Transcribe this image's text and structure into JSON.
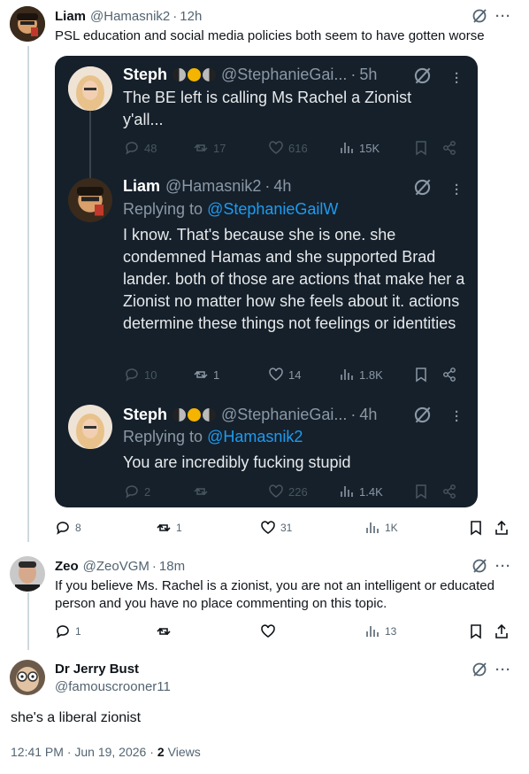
{
  "main_post": {
    "author_name": "Liam",
    "handle": "@Hamasnik2",
    "time": "12h",
    "text": "PSL education and social media policies both seem to have gotten worse",
    "stats": {
      "replies": "8",
      "reposts": "1",
      "likes": "31",
      "views": "1K"
    }
  },
  "card": {
    "posts": [
      {
        "author_name": "Steph",
        "handle": "@StephanieGai...",
        "time": "5h",
        "text": "The BE left is calling Ms Rachel a Zionist y'all...",
        "stats": {
          "replies": "48",
          "reposts": "17",
          "likes": "616",
          "views": "15K"
        }
      },
      {
        "author_name": "Liam",
        "handle": "@Hamasnik2",
        "time": "4h",
        "replying_label": "Replying to",
        "replying_to": "@StephanieGailW",
        "text": "I know. That's because she is one. she condemned Hamas and she supported Brad lander. both of those are actions that make her a Zionist no matter how she feels about it. actions determine these things not feelings or identities",
        "stats": {
          "replies": "10",
          "reposts": "1",
          "likes": "14",
          "views": "1.8K"
        }
      },
      {
        "author_name": "Steph",
        "handle": "@StephanieGai...",
        "time": "4h",
        "replying_label": "Replying to",
        "replying_to": "@Hamasnik2",
        "text": "You are incredibly fucking stupid",
        "stats": {
          "replies": "2",
          "reposts": "",
          "likes": "226",
          "views": "1.4K"
        }
      }
    ]
  },
  "reply_zeo": {
    "author_name": "Zeo",
    "handle": "@ZeoVGM",
    "time": "18m",
    "text": "If you believe Ms. Rachel is a zionist, you are not an intelligent or educated person and you have no place commenting on this topic.",
    "stats": {
      "replies": "1",
      "reposts": "",
      "likes": "",
      "views": "13"
    }
  },
  "focused_post": {
    "author_name": "Dr Jerry Bust",
    "handle": "@famouscrooner11",
    "text": "she's a liberal zionist",
    "timestamp": "12:41 PM · Jun 19, 2026 ·",
    "views_count": "2",
    "views_label": "Views"
  },
  "sep": "·",
  "more_glyph": "···",
  "colors": {
    "card_bg": "#15202b",
    "link": "#1d9bf0",
    "thread_line": "#cfd9de",
    "muted": "#536471"
  }
}
